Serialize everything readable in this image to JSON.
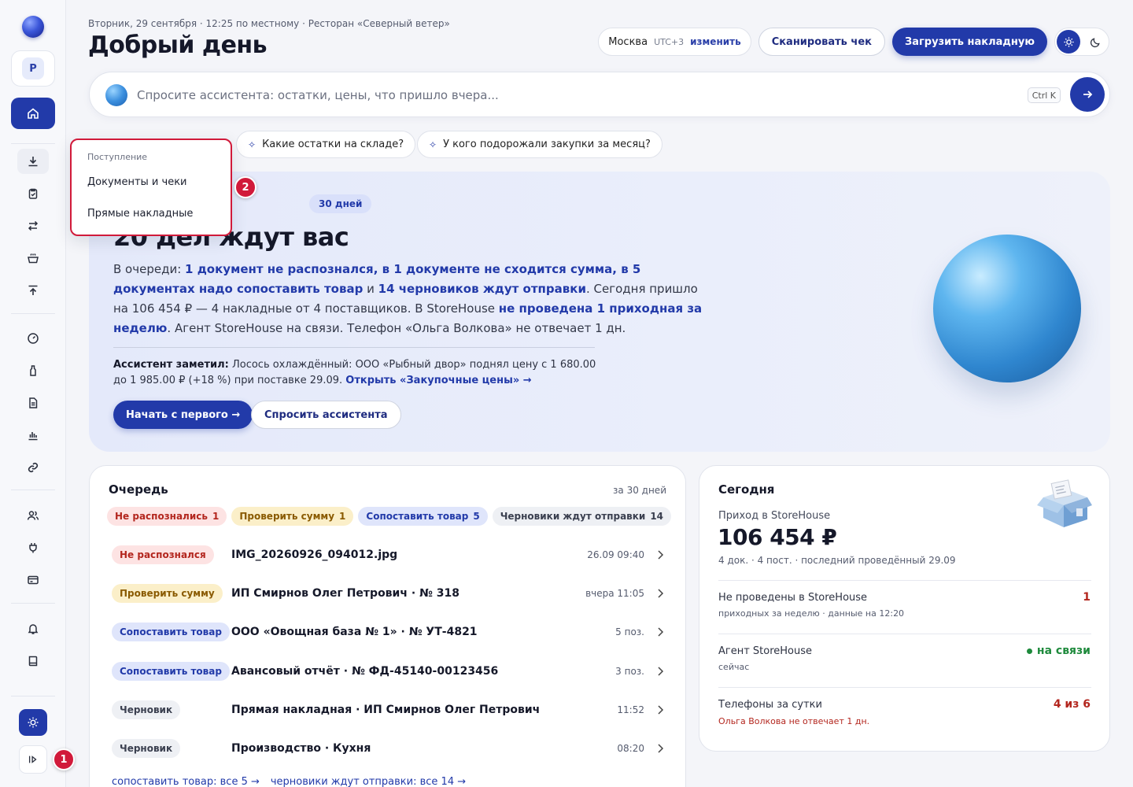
{
  "header": {
    "date_line": "Вторник, 29 сентября · 12:25 по местному · Ресторан «Северный ветер»",
    "greeting": "Добрый день",
    "city": "Москва",
    "timezone": "UTC+3",
    "change_label": "изменить",
    "scan_button": "Сканировать чек",
    "upload_button": "Загрузить накладную"
  },
  "sidebar": {
    "avatar_letter": "P",
    "collapse_tooltip": ""
  },
  "search": {
    "placeholder": "Спросите ассистента: остатки, цены, что пришло вчера...",
    "shortcut": "Ctrl K"
  },
  "suggestions": [
    "Какие остатки на складе?",
    "У кого подорожали закупки за месяц?"
  ],
  "dropdown": {
    "heading": "Поступление",
    "items": [
      "Документы и чеки",
      "Прямые накладные"
    ]
  },
  "markers": {
    "one": "1",
    "two": "2"
  },
  "hero": {
    "chip": "30 дней",
    "title": "20 дел ждут вас",
    "text_prefix": "В очереди: ",
    "link1": "1 документ не распознался",
    "sep1": ", ",
    "link2": "в 1 документе не сходится сумма",
    "sep2": ", ",
    "link3": "в 5 документах надо сопоставить товар",
    "sep3": " и ",
    "link4": "14 черновиков ждут отправки",
    "text_mid": ". Сегодня пришло на 106 454 ₽ — 4 накладные от 4 поставщиков. В StoreHouse ",
    "link5": "не проведена 1 приходная за неделю",
    "text_end": ". Агент StoreHouse на связи. Телефон «Ольга Волкова» не отвечает 1 дн.",
    "note_label": "Ассистент заметил:",
    "note_text": " Лосось охлаждённый: ООО «Рыбный двор» поднял цену с 1 680.00 до 1 985.00 ₽ (+18 %) при поставке 29.09. ",
    "note_link": "Открыть «Закупочные цены» →",
    "btn_start": "Начать с первого →",
    "btn_ask": "Спросить ассистента"
  },
  "queue": {
    "title": "Очередь",
    "period": "за 30 дней",
    "filters": [
      {
        "label": "Не распознались",
        "count": "1"
      },
      {
        "label": "Проверить сумму",
        "count": "1"
      },
      {
        "label": "Сопоставить товар",
        "count": "5"
      },
      {
        "label": "Черновики ждут отправки",
        "count": "14"
      }
    ],
    "rows": [
      {
        "status": "Не распознался",
        "name": "IMG_20260926_094012.jpg",
        "meta": "26.09 09:40"
      },
      {
        "status": "Проверить сумму",
        "name": "ИП Смирнов Олег Петрович · № 318",
        "meta": "вчера 11:05"
      },
      {
        "status": "Сопоставить товар",
        "name": "ООО «Овощная база № 1» · № УТ-4821",
        "meta": "5 поз."
      },
      {
        "status": "Сопоставить товар",
        "name": "Авансовый отчёт · № ФД-45140-00123456",
        "meta": "3 поз."
      },
      {
        "status": "Черновик",
        "name": "Прямая накладная · ИП Смирнов Олег Петрович",
        "meta": "11:52"
      },
      {
        "status": "Черновик",
        "name": "Производство · Кухня",
        "meta": "08:20"
      }
    ],
    "link_match": "сопоставить товар: все 5 →",
    "link_drafts": "черновики ждут отправки: все 14 →"
  },
  "today": {
    "title": "Сегодня",
    "income_label": "Приход в StoreHouse",
    "income_value": "106 454 ₽",
    "income_sub": "4 док. · 4 пост. · последний проведённый 29.09",
    "rows": [
      {
        "title": "Не проведены в StoreHouse",
        "sub": "приходных за неделю · данные на 12:20",
        "value": "1"
      },
      {
        "title": "Агент StoreHouse",
        "sub": "сейчас",
        "value": "на связи"
      },
      {
        "title": "Телефоны за сутки",
        "sub": "Ольга Волкова не отвечает 1 дн.",
        "value": "4 из 6"
      }
    ]
  },
  "colors": {
    "accent": "#223aa9",
    "danger": "#b3261e",
    "success": "#1e8a3c",
    "marker": "#d11a3a"
  }
}
